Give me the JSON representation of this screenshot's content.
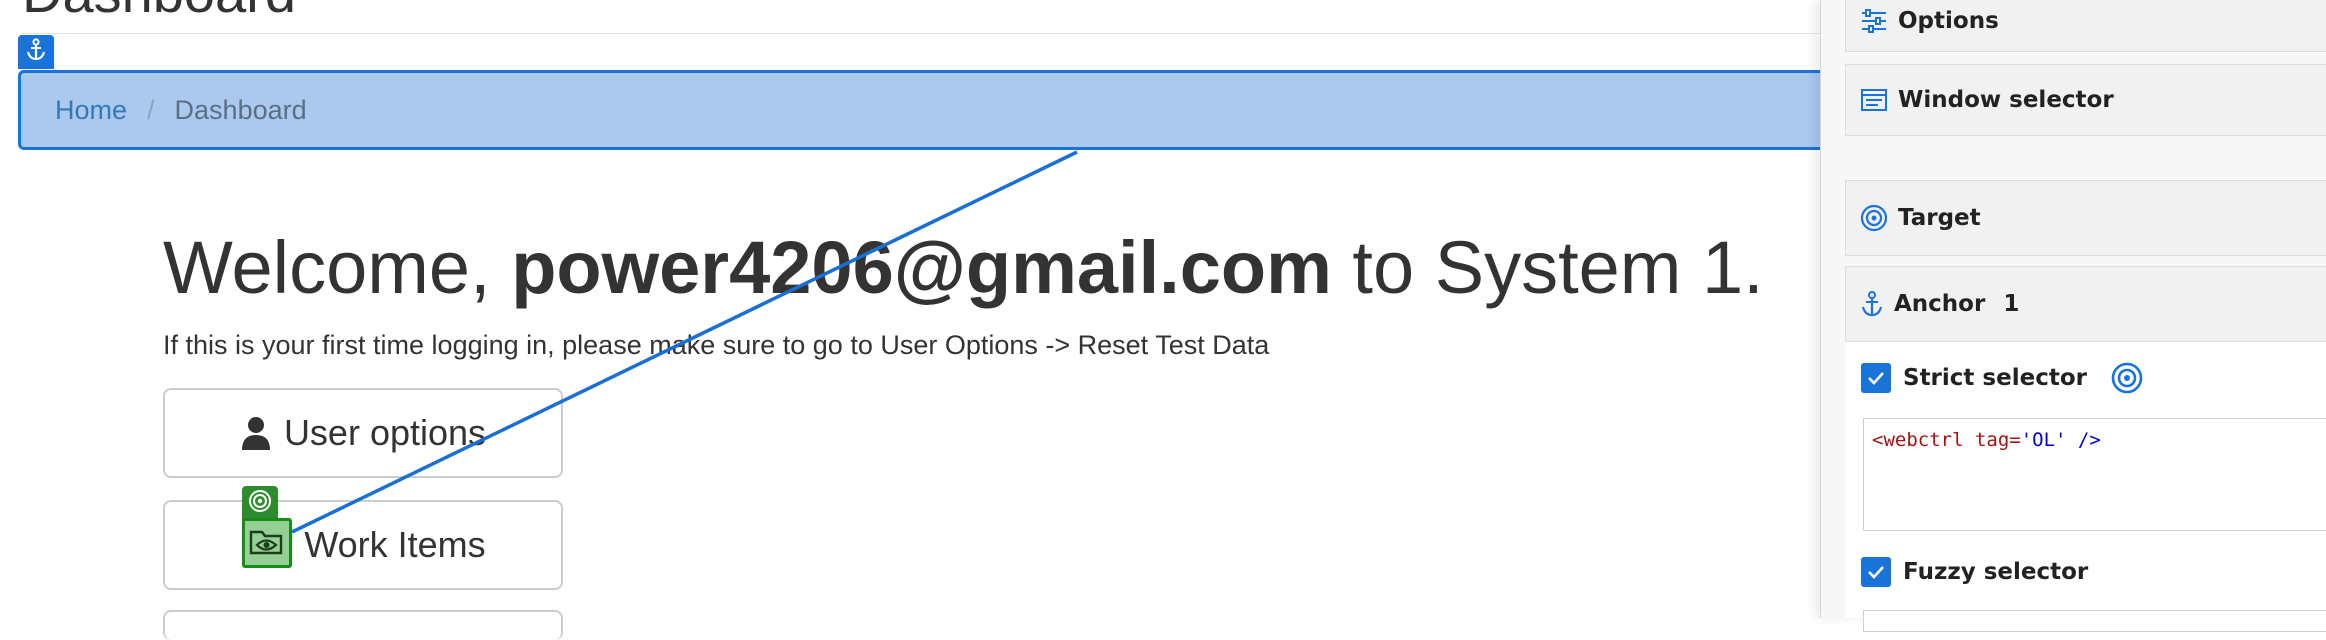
{
  "page": {
    "title": "Dashboard",
    "breadcrumb": {
      "home": "Home",
      "separator": "/",
      "current": "Dashboard"
    },
    "welcome": {
      "prefix": "Welcome, ",
      "user": "power4206@gmail.com",
      "suffix": " to System 1."
    },
    "notice": "If this is your first time logging in, please make sure to go to User Options -> Reset Test Data",
    "buttons": {
      "user_options": "User options",
      "work_items": "Work Items"
    }
  },
  "panel": {
    "options_label": "Options",
    "window_selector_label": "Window selector",
    "target_label": "Target",
    "anchor_label": "Anchor",
    "anchor_count": "1",
    "strict_selector_label": "Strict selector",
    "strict_selector_checked": true,
    "selector_code": {
      "open": "<webctrl ",
      "attr": "tag=",
      "value": "'OL'",
      "close": " />"
    },
    "fuzzy_selector_label": "Fuzzy selector",
    "fuzzy_selector_checked": true
  },
  "colors": {
    "anchor_highlight": "#1a73d9",
    "anchor_fill": "#abc8ed",
    "target_highlight": "#178a17",
    "link": "#337ab7"
  },
  "icons": {
    "anchor": "anchor-icon",
    "target": "target-icon",
    "user": "user-icon",
    "work_items": "folder-eye-icon",
    "options": "sliders-icon",
    "window": "window-icon",
    "check": "check-icon"
  }
}
